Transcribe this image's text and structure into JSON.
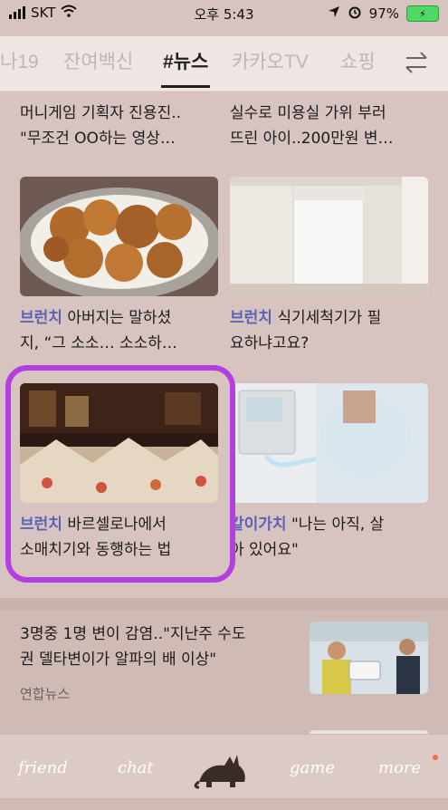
{
  "status": {
    "carrier": "SKT",
    "time": "오후 5:43",
    "battery": "97%"
  },
  "tabs": [
    {
      "label": "나19"
    },
    {
      "label": "잔여백신"
    },
    {
      "label": "#뉴스"
    },
    {
      "label": "카카오TV"
    },
    {
      "label": "쇼핑"
    }
  ],
  "feed": {
    "top_left": [
      "머니게임 기획자 진용진..",
      "\"무조건 OO하는 영상…"
    ],
    "top_right": [
      "실수로 미용실 가위 부러",
      "뜨린 아이..200만원 변…"
    ],
    "row2_left": {
      "tag": "브런치",
      "line1": " 아버지는 말하셨",
      "line2": "지, “그 소소… 소소하…"
    },
    "row2_right": {
      "tag": "브런치",
      "line1": " 식기세척기가 필",
      "line2": "요하냐고요?"
    },
    "row3_left": {
      "tag": "브런치",
      "line1": " 바르셀로나에서",
      "line2": "소매치기와 동행하는 법"
    },
    "row3_right": {
      "tag": "같이가치",
      "line1": " \"나는 아직, 살",
      "line2": "아 있어요\""
    }
  },
  "news": {
    "headline_line1": "3명중 1명 변이 감염..\"지난주 수도",
    "headline_line2": "권 델타변이가 알파의 배 이상\"",
    "source": "연합뉴스"
  },
  "nav": {
    "friend": "friend",
    "chat": "chat",
    "game": "game",
    "more": "more"
  }
}
